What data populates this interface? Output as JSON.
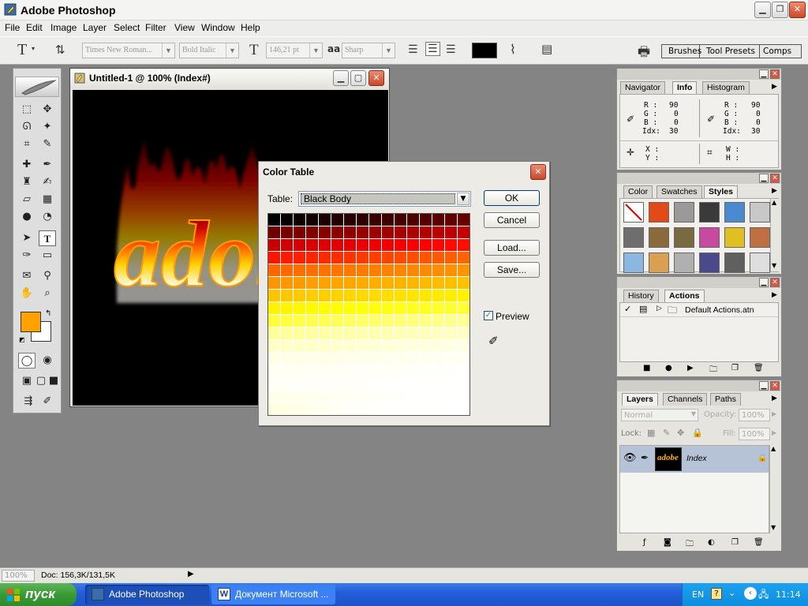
{
  "app": {
    "title": "Adobe Photoshop"
  },
  "menu": [
    "File",
    "Edit",
    "Image",
    "Layer",
    "Select",
    "Filter",
    "View",
    "Window",
    "Help"
  ],
  "options": {
    "tool_glyph": "T",
    "font_family": "Times New Roman...",
    "font_style": "Bold Italic",
    "font_size": "146,21 pt",
    "aa_label": "aa",
    "antialias": "Sharp",
    "text_color": "#000000",
    "palette_tabs": [
      "Brushes",
      "Tool Presets",
      "Comps"
    ]
  },
  "toolbox": {
    "foreground_color": "#ffa200",
    "background_color": "#ffffff"
  },
  "document": {
    "title": "Untitled-1 @ 100% (Index#)",
    "artwork_text": "adobe"
  },
  "dialog": {
    "title": "Color Table",
    "table_label": "Table:",
    "table_value": "Black Body",
    "ok": "OK",
    "cancel": "Cancel",
    "load": "Load...",
    "save": "Save...",
    "preview_label": "Preview",
    "preview_checked": true,
    "swatch_colors": [
      "#000000",
      "#070000",
      "#0e0000",
      "#150000",
      "#1c0000",
      "#230000",
      "#2a0000",
      "#310000",
      "#380000",
      "#3f0000",
      "#460000",
      "#4d0000",
      "#540000",
      "#5b0000",
      "#620000",
      "#690000",
      "#700000",
      "#760000",
      "#7b0000",
      "#810000",
      "#860000",
      "#8c0000",
      "#910000",
      "#970000",
      "#9c0000",
      "#a20000",
      "#a70000",
      "#ad0000",
      "#b20000",
      "#b80000",
      "#bd0000",
      "#c30000",
      "#c80000",
      "#ce0000",
      "#d30000",
      "#d90000",
      "#dd0000",
      "#e10000",
      "#e50000",
      "#e90000",
      "#ed0000",
      "#f10000",
      "#f50000",
      "#f90000",
      "#fd0000",
      "#ff0400",
      "#ff0900",
      "#ff0e00",
      "#ff1400",
      "#ff1900",
      "#ff1e00",
      "#ff2400",
      "#ff2900",
      "#ff2e00",
      "#ff3400",
      "#ff3900",
      "#ff3e00",
      "#ff4400",
      "#ff4900",
      "#ff4e00",
      "#ff5400",
      "#ff5900",
      "#ff5e00",
      "#ff6400",
      "#ff6600",
      "#ff6900",
      "#ff6c00",
      "#ff6f00",
      "#ff7200",
      "#ff7500",
      "#ff7800",
      "#ff7b00",
      "#ff7e00",
      "#ff8100",
      "#ff8400",
      "#ff8700",
      "#ff8a00",
      "#ff8d00",
      "#ff9000",
      "#ff9300",
      "#ff9500",
      "#ff9800",
      "#ff9b00",
      "#ff9e00",
      "#ffa100",
      "#ffa400",
      "#ffa700",
      "#ffaa00",
      "#ffad00",
      "#ffb000",
      "#ffb300",
      "#ffb600",
      "#ffb900",
      "#ffbc00",
      "#ffbf00",
      "#ffc200",
      "#ffc400",
      "#ffc700",
      "#ffca00",
      "#ffcd00",
      "#ffd000",
      "#ffd300",
      "#ffd600",
      "#ffd900",
      "#ffdc00",
      "#ffdf00",
      "#ffe200",
      "#ffe500",
      "#ffe800",
      "#ffeb00",
      "#ffee00",
      "#fff100",
      "#fff300",
      "#fff500",
      "#fff700",
      "#fff900",
      "#fffb00",
      "#fffd00",
      "#ffff00",
      "#ffff06",
      "#ffff0c",
      "#ffff12",
      "#ffff18",
      "#ffff1e",
      "#ffff24",
      "#ffff2a",
      "#ffff30",
      "#ffff36",
      "#ffff3c",
      "#ffff42",
      "#ffff48",
      "#ffff4e",
      "#ffff54",
      "#ffff5a",
      "#ffff60",
      "#ffff66",
      "#ffff6c",
      "#ffff72",
      "#ffff78",
      "#ffff7e",
      "#ffff84",
      "#ffff8a",
      "#ffff90",
      "#ffff96",
      "#ffff98",
      "#ffff9b",
      "#ffff9e",
      "#ffffa1",
      "#ffffa4",
      "#ffffa7",
      "#ffffaa",
      "#ffffad",
      "#ffffb0",
      "#ffffb3",
      "#ffffb6",
      "#ffffb9",
      "#ffffbc",
      "#ffffbf",
      "#ffffc2",
      "#ffffc5",
      "#ffffc6",
      "#ffffc8",
      "#ffffca",
      "#ffffcc",
      "#ffffce",
      "#ffffd0",
      "#ffffd2",
      "#ffffd4",
      "#ffffd6",
      "#ffffd8",
      "#ffffda",
      "#ffffdc",
      "#ffffde",
      "#ffffe0",
      "#ffffe2",
      "#ffffe4",
      "#ffffe4",
      "#ffffe5",
      "#ffffe6",
      "#ffffe7",
      "#ffffe8",
      "#ffffe9",
      "#ffffea",
      "#ffffeb",
      "#ffffec",
      "#ffffed",
      "#ffffee",
      "#ffffef",
      "#fffff0",
      "#fffff1",
      "#fffff2",
      "#fffff3",
      "#fffff3",
      "#fffff4",
      "#fffff4",
      "#fffff5",
      "#fffff5",
      "#fffff6",
      "#fffff6",
      "#fffff7",
      "#fffff7",
      "#fffff8",
      "#fffff8",
      "#fffff9",
      "#fffff9",
      "#fffffa",
      "#fffffa",
      "#fffffb",
      "#fffff8",
      "#fffff8",
      "#fffff9",
      "#fffff9",
      "#fffff9",
      "#fffffa",
      "#fffffa",
      "#fffffa",
      "#fffffb",
      "#fffffb",
      "#fffffb",
      "#fffffc",
      "#fffffc",
      "#fffffc",
      "#fffffd",
      "#fffffd",
      "#ffffe8",
      "#ffffea",
      "#ffffec",
      "#ffffee",
      "#fffff0",
      "#fffff2",
      "#fffff4",
      "#fffff6",
      "#fffff8",
      "#fffffa",
      "#fffffa",
      "#fffffb",
      "#fffffb",
      "#fffffc",
      "#fffffc",
      "#fffffd",
      "#ffffe0",
      "#ffffe4",
      "#ffffe8",
      "#ffffec",
      "#fffff0",
      "#fffff4",
      "#fffff8",
      "#fffffa",
      "#fffffb",
      "#fffffc",
      "#fffffd",
      "#fffffd",
      "#fffffe",
      "#fffffe",
      "#ffffff",
      "#ffffff"
    ]
  },
  "navigator": {
    "tabs": [
      "Navigator",
      "Info",
      "Histogram"
    ],
    "active_tab": "Info",
    "info_left": {
      "R": "90",
      "G": "0",
      "B": "0",
      "Idx": "30"
    },
    "info_right": {
      "R": "90",
      "G": "0",
      "B": "0",
      "Idx": "30"
    },
    "labels": {
      "r": "R :",
      "g": "G :",
      "b": "B :",
      "idx": "Idx:",
      "x": "X :",
      "y": "Y :",
      "w": "W :",
      "h": "H :"
    }
  },
  "styles": {
    "tabs": [
      "Color",
      "Swatches",
      "Styles"
    ],
    "active_tab": "Styles",
    "swatches": [
      "#ffffff",
      "#e24b18",
      "#9a9a9a",
      "#3a3a3a",
      "#4a8ad0",
      "#c8c8c8",
      "#6e6e6e",
      "#8a6a3a",
      "#7a6a40",
      "#c84aa0",
      "#e0c020",
      "#c07040",
      "#8ab8e0",
      "#d8a050",
      "#b0b0b0",
      "#4a4a8a",
      "#606060",
      "#dedede"
    ]
  },
  "actions": {
    "tabs": [
      "History",
      "Actions"
    ],
    "active_tab": "Actions",
    "item": "Default Actions.atn"
  },
  "layers": {
    "tabs": [
      "Layers",
      "Channels",
      "Paths"
    ],
    "active_tab": "Layers",
    "blend_mode": "Normal",
    "opacity_label": "Opacity:",
    "opacity": "100%",
    "lock_label": "Lock:",
    "fill_label": "Fill:",
    "fill": "100%",
    "layer_name": "Index"
  },
  "status": {
    "zoom": "100%",
    "doc": "Doc: 156,3K/131,5K"
  },
  "taskbar": {
    "start": "пуск",
    "tasks": [
      "Adobe Photoshop",
      "Документ Microsoft ..."
    ],
    "lang": "EN",
    "clock": "11:14"
  }
}
